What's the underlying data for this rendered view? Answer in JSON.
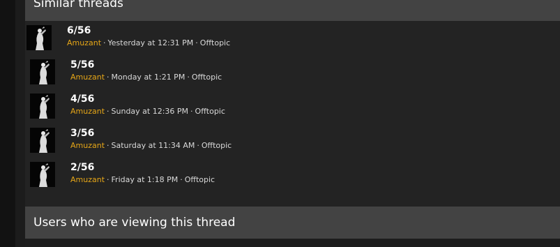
{
  "similar": {
    "heading": "Similar threads",
    "threads": [
      {
        "title": "6/56",
        "author": "Amuzant",
        "date": "Yesterday at 12:31 PM",
        "forum": "Offtopic"
      },
      {
        "title": "5/56",
        "author": "Amuzant",
        "date": "Monday at 1:21 PM",
        "forum": "Offtopic"
      },
      {
        "title": "4/56",
        "author": "Amuzant",
        "date": "Sunday at 12:36 PM",
        "forum": "Offtopic"
      },
      {
        "title": "3/56",
        "author": "Amuzant",
        "date": "Saturday at 11:34 AM",
        "forum": "Offtopic"
      },
      {
        "title": "2/56",
        "author": "Amuzant",
        "date": "Friday at 1:18 PM",
        "forum": "Offtopic"
      }
    ]
  },
  "viewers": {
    "heading": "Users who are viewing this thread"
  },
  "meta_separator": "·",
  "colors": {
    "header_bg": "#434343",
    "body_bg": "#232323",
    "author": "#e6a617",
    "title": "#ffffff"
  }
}
